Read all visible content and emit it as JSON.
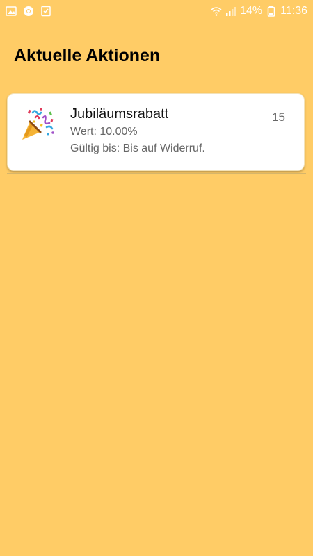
{
  "status_bar": {
    "battery": "14%",
    "time": "11:36",
    "icons": [
      "gallery-icon",
      "chrome-icon",
      "task-icon",
      "wifi-icon",
      "signal-icon",
      "battery-icon"
    ]
  },
  "page": {
    "title": "Aktuelle Aktionen"
  },
  "promotions": [
    {
      "icon": "party-popper-icon",
      "title": "Jubiläumsrabatt",
      "value": "Wert: 10.00%",
      "valid_until": "Gültig bis: Bis auf Widerruf.",
      "count": "15"
    }
  ],
  "colors": {
    "background": "#FFCC66",
    "card": "#FFFFFF",
    "title": "#000000",
    "secondary_text": "#666666"
  }
}
